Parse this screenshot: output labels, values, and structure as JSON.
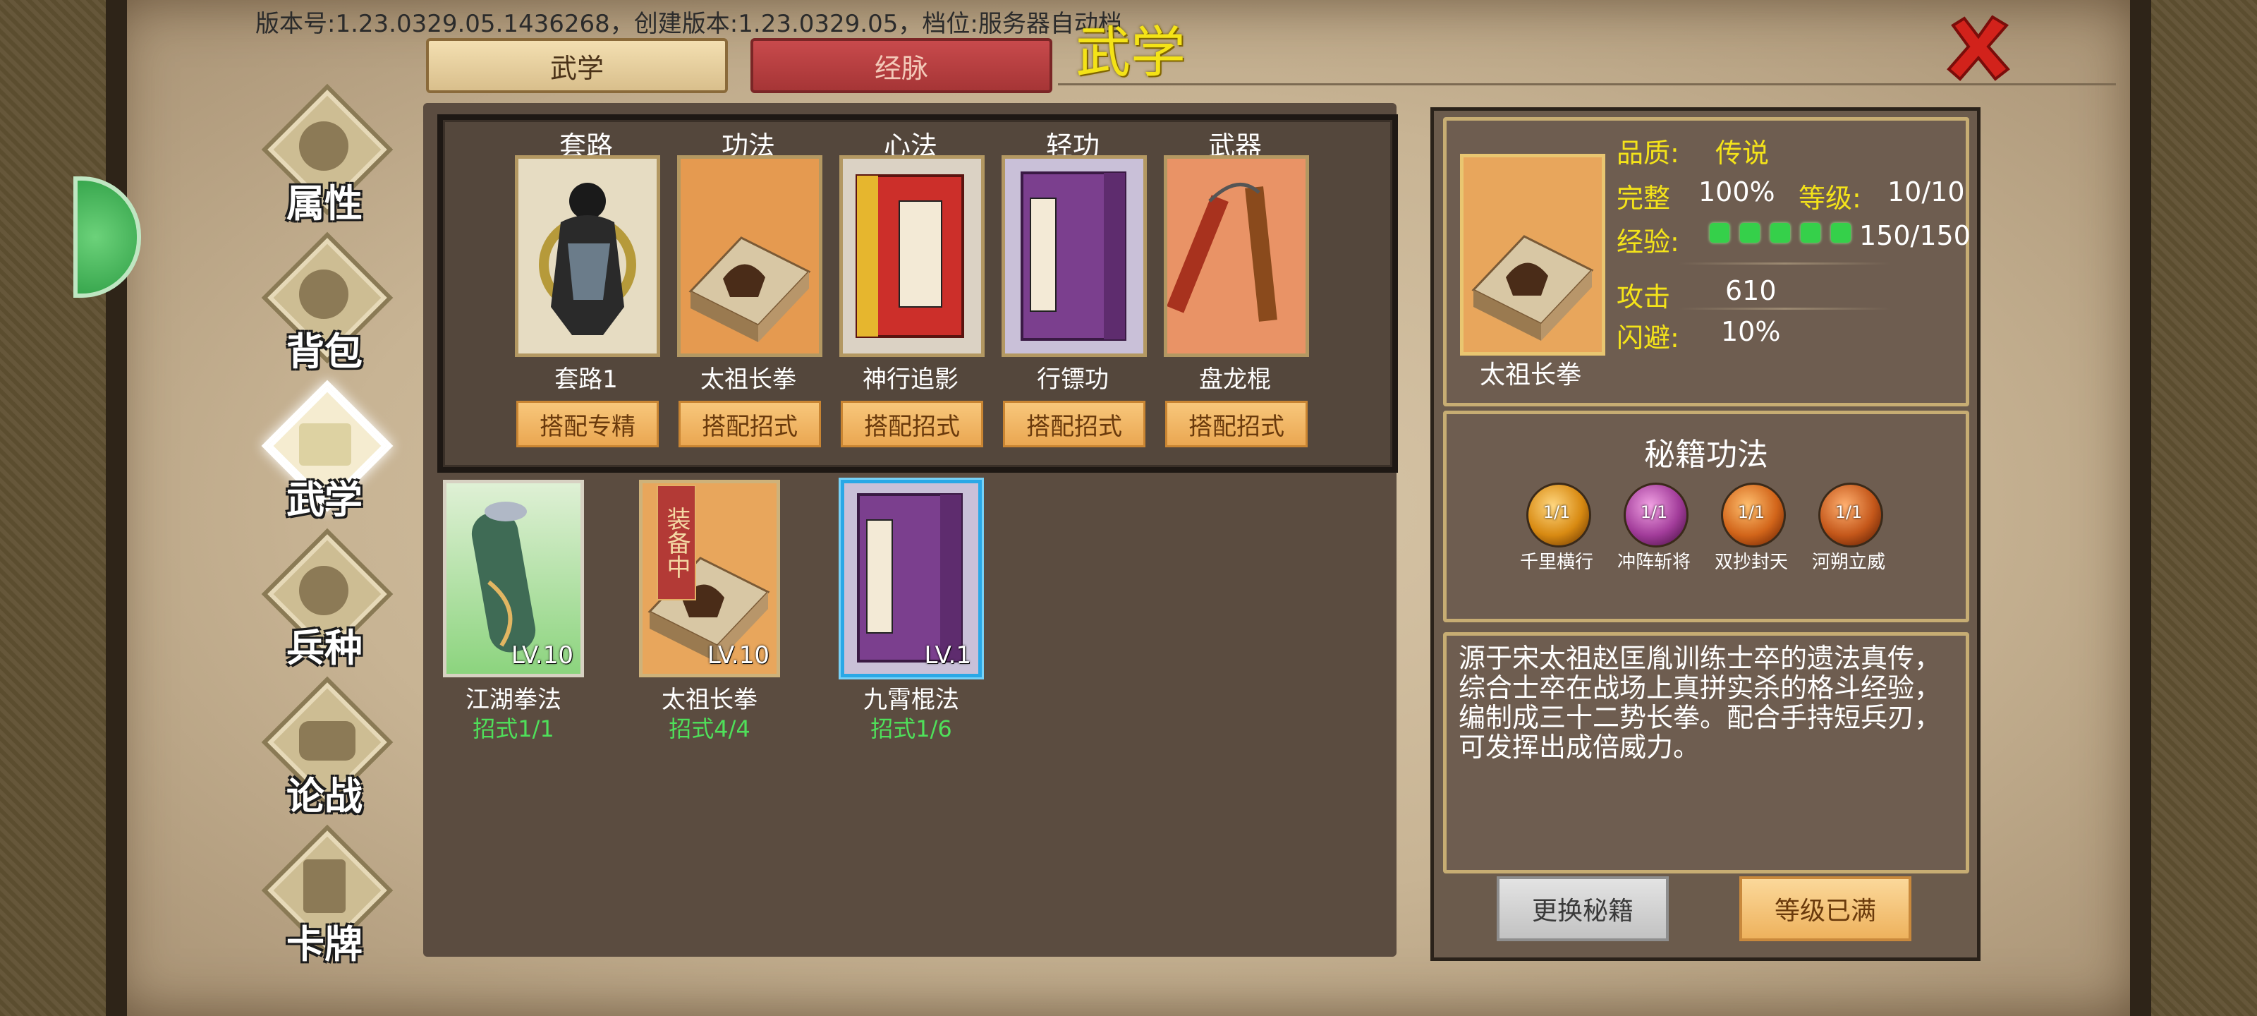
{
  "header": {
    "version_text": "版本号:1.23.0329.05.1436268，创建版本:1.23.0329.05，档位:服务器自动档",
    "title": "武学"
  },
  "tabs": [
    {
      "label": "武学",
      "active": true
    },
    {
      "label": "经脉",
      "active": false
    }
  ],
  "nav": [
    {
      "label": "属性",
      "icon": "person-icon"
    },
    {
      "label": "背包",
      "icon": "bag-icon"
    },
    {
      "label": "武学",
      "icon": "book-icon",
      "active": true
    },
    {
      "label": "兵种",
      "icon": "cavalry-icon"
    },
    {
      "label": "论战",
      "icon": "chat-bubble-icon"
    },
    {
      "label": "卡牌",
      "icon": "cards-icon"
    }
  ],
  "slots": [
    {
      "category": "套路",
      "name": "套路1",
      "button": "搭配专精",
      "icon": "warrior-portrait-icon"
    },
    {
      "category": "功法",
      "name": "太祖长拳",
      "button": "搭配招式",
      "icon": "manual-book-icon"
    },
    {
      "category": "心法",
      "name": "神行追影",
      "button": "搭配招式",
      "icon": "red-book-icon"
    },
    {
      "category": "轻功",
      "name": "行镖功",
      "button": "搭配招式",
      "icon": "purple-book-icon"
    },
    {
      "category": "武器",
      "name": "盘龙棍",
      "button": "搭配招式",
      "icon": "nunchaku-icon"
    }
  ],
  "inventory": [
    {
      "name": "江湖拳法",
      "level": "LV.10",
      "moves": "招式1/1",
      "icon": "scroll-icon"
    },
    {
      "name": "太祖长拳",
      "level": "LV.10",
      "moves": "招式4/4",
      "icon": "manual-book-icon",
      "badge": "装备中"
    },
    {
      "name": "九霄棍法",
      "level": "LV.1",
      "moves": "招式1/6",
      "icon": "purple-book-icon",
      "selected": true
    }
  ],
  "detail": {
    "name": "太祖长拳",
    "quality_label": "品质:",
    "quality_value": "传说",
    "complete_label": "完整",
    "complete_value": "100%",
    "level_label": "等级:",
    "level_value": "10/10",
    "exp_label": "经验:",
    "exp_value": "150/150",
    "exp_pips": 5,
    "attack_label": "攻击",
    "attack_value": "610",
    "dodge_label": "闪避:",
    "dodge_value": "10%"
  },
  "secrets": {
    "title": "秘籍功法",
    "skills": [
      {
        "name": "千里横行",
        "count": "1/1",
        "color": "#d88a12"
      },
      {
        "name": "冲阵斩将",
        "count": "1/1",
        "color": "#a23c9a"
      },
      {
        "name": "双抄封天",
        "count": "1/1",
        "color": "#d2651a"
      },
      {
        "name": "河朔立威",
        "count": "1/1",
        "color": "#c4571a"
      }
    ]
  },
  "description": "源于宋太祖赵匡胤训练士卒的遗法真传，综合士卒在战场上真拼实杀的格斗经验，编制成三十二势长拳。配合手持短兵刃，可发挥出成倍威力。",
  "buttons": {
    "change": "更换秘籍",
    "maxed": "等级已满"
  }
}
